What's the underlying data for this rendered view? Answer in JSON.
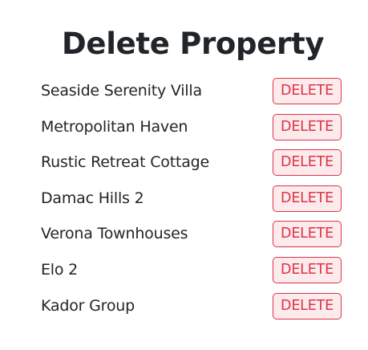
{
  "page": {
    "title": "Delete Property"
  },
  "properties": [
    {
      "name": "Seaside Serenity Villa",
      "action": "DELETE"
    },
    {
      "name": "Metropolitan Haven",
      "action": "DELETE"
    },
    {
      "name": "Rustic Retreat Cottage",
      "action": "DELETE"
    },
    {
      "name": "Damac Hills 2",
      "action": "DELETE"
    },
    {
      "name": "Verona Townhouses",
      "action": "DELETE"
    },
    {
      "name": "Elo 2",
      "action": "DELETE"
    },
    {
      "name": "Kador Group",
      "action": "DELETE"
    }
  ],
  "colors": {
    "danger": "#dc3545",
    "danger_bg": "#fdeaec",
    "text": "#212529"
  }
}
